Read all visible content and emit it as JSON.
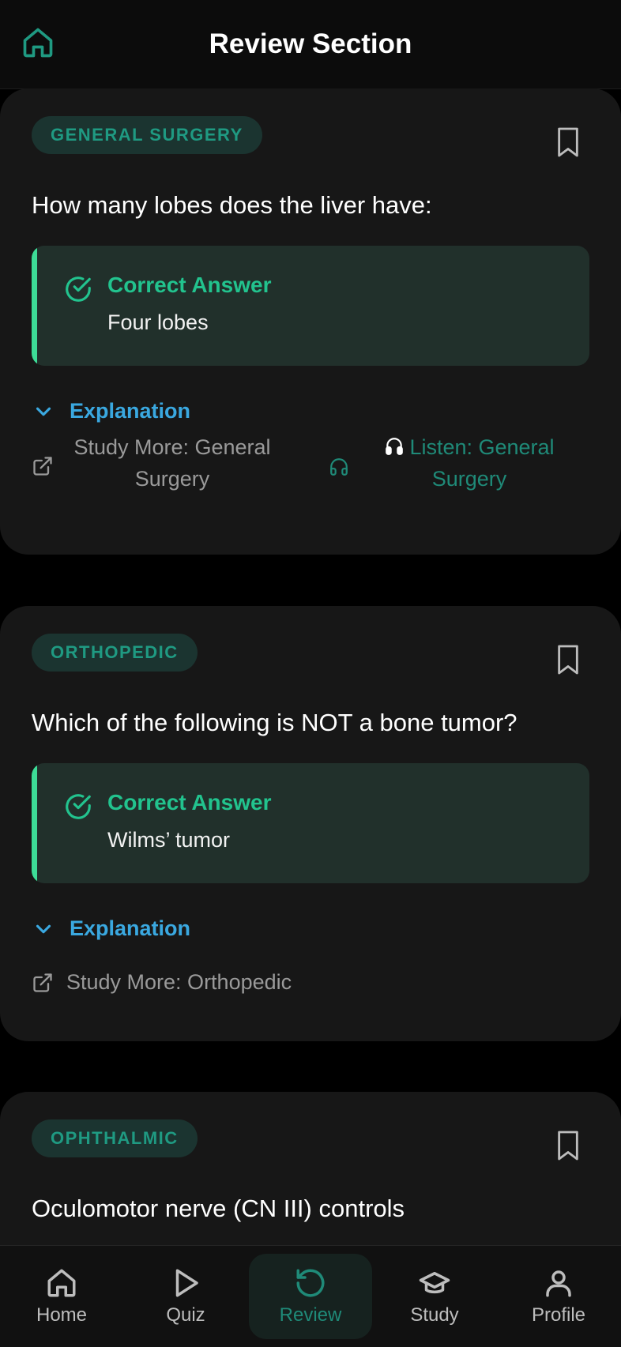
{
  "header": {
    "title": "Review Section"
  },
  "cards": [
    {
      "tag": "GENERAL SURGERY",
      "question": "How many lobes does the liver have:",
      "answer_title": "Correct Answer",
      "answer": "Four lobes",
      "explanation_label": "Explanation",
      "study_more_line1": "Study More: General",
      "study_more_line2": "Surgery",
      "listen_line1": "Listen: General",
      "listen_line2": "Surgery"
    },
    {
      "tag": "ORTHOPEDIC",
      "question": "Which of the following is NOT a bone tumor?",
      "answer_title": "Correct Answer",
      "answer": "Wilms’ tumor",
      "explanation_label": "Explanation",
      "study_more": "Study More: Orthopedic"
    },
    {
      "tag": "OPHTHALMIC",
      "question": "Oculomotor nerve (CN III) controls"
    }
  ],
  "nav": {
    "items": [
      {
        "label": "Home",
        "icon": "home-icon"
      },
      {
        "label": "Quiz",
        "icon": "play-icon"
      },
      {
        "label": "Review",
        "icon": "refresh-icon",
        "active": true
      },
      {
        "label": "Study",
        "icon": "graduation-cap-icon"
      },
      {
        "label": "Profile",
        "icon": "user-icon"
      }
    ]
  },
  "colors": {
    "accent": "#1f9a82",
    "correct": "#22c38e",
    "link": "#3aa8e0",
    "card_bg": "#171717"
  }
}
